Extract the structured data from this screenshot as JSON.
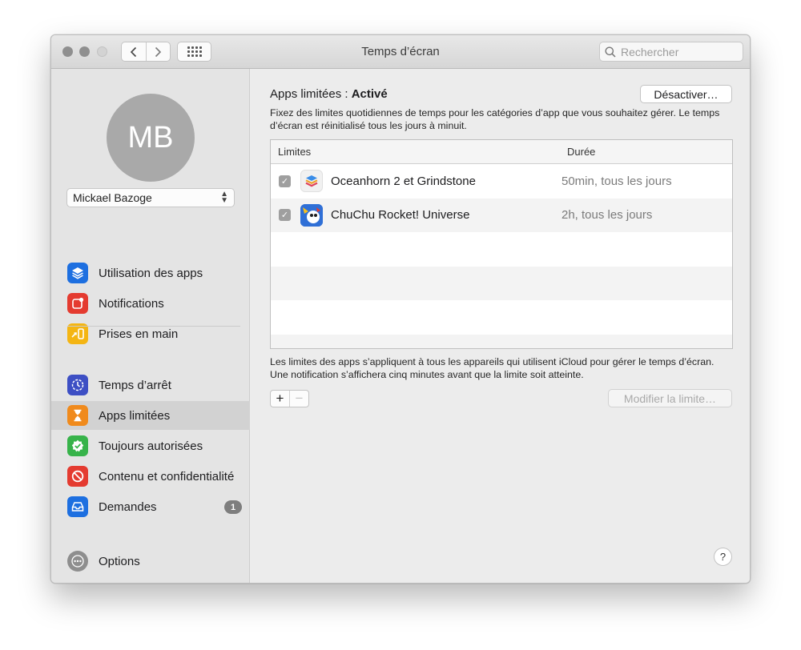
{
  "window": {
    "title": "Temps d’écran"
  },
  "search": {
    "placeholder": "Rechercher"
  },
  "nav": {
    "back": "‹",
    "forward": "›"
  },
  "user": {
    "initials": "MB",
    "name": "Mickael Bazoge"
  },
  "sidebar": {
    "items": [
      {
        "label": "Utilisation des apps",
        "icon": "layers-icon",
        "color": "#1d6fe0"
      },
      {
        "label": "Notifications",
        "icon": "notification-icon",
        "color": "#e43b30"
      },
      {
        "label": "Prises en main",
        "icon": "pickup-icon",
        "color": "#f4b513"
      },
      {
        "label": "Temps d’arrêt",
        "icon": "downtime-icon",
        "color": "#3d4fc4"
      },
      {
        "label": "Apps limitées",
        "icon": "hourglass-icon",
        "color": "#f08a1c"
      },
      {
        "label": "Toujours autorisées",
        "icon": "checkmark-shield-icon",
        "color": "#37b34a"
      },
      {
        "label": "Contenu et confidentialité",
        "icon": "restriction-icon",
        "color": "#e43b30"
      },
      {
        "label": "Demandes",
        "icon": "inbox-icon",
        "color": "#1d6fe0",
        "badge": "1"
      }
    ],
    "selected": "Apps limitées",
    "options_label": "Options"
  },
  "main": {
    "status_prefix": "Apps limitées : ",
    "status_value": "Activé",
    "disable_button": "Désactiver…",
    "description": "Fixez des limites quotidiennes de temps pour les catégories d’app que vous souhaitez gérer. Le temps d’écran est réinitialisé tous les jours à minuit.",
    "table": {
      "columns": [
        "Limites",
        "Durée"
      ],
      "rows": [
        {
          "name": "Oceanhorn 2 et Grindstone",
          "duration": "50min, tous les jours",
          "checked": true
        },
        {
          "name": "ChuChu Rocket! Universe",
          "duration": "2h, tous les jours",
          "checked": true
        }
      ]
    },
    "footnote": "Les limites des apps s’appliquent à tous les appareils qui utilisent iCloud pour gérer le temps d’écran. Une notification s’affichera cinq minutes avant que la limite soit atteinte.",
    "add_label": "+",
    "remove_label": "−",
    "modify_button": "Modifier la limite…",
    "help_label": "?"
  }
}
